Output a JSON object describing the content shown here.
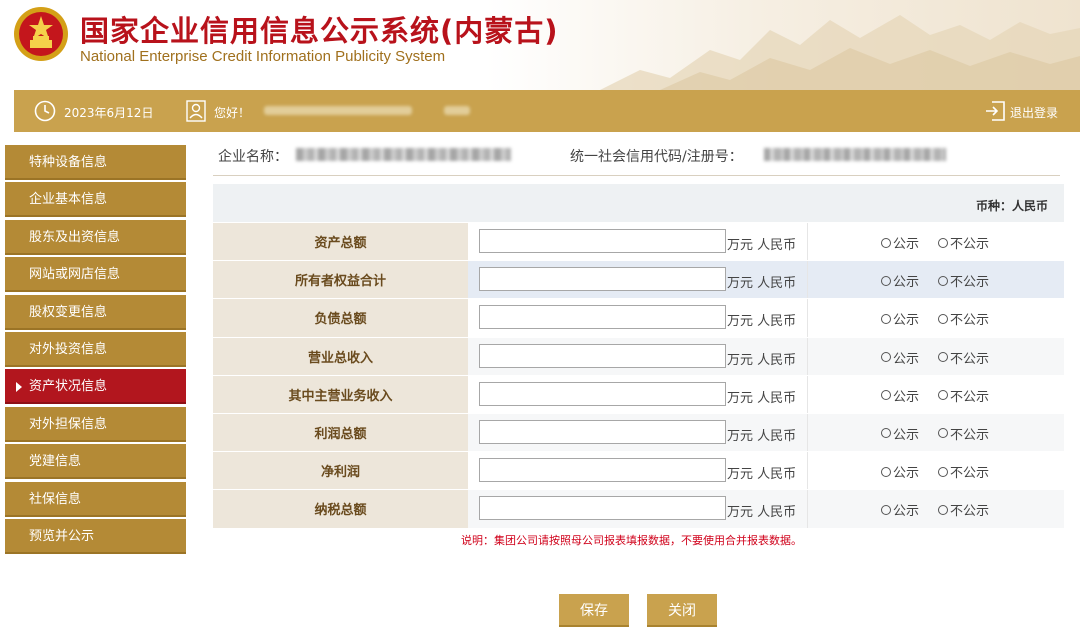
{
  "header": {
    "title_cn": "国家企业信用信息公示系统(内蒙古)",
    "title_en": "National Enterprise Credit Information Publicity System"
  },
  "topbar": {
    "date": "2023年6月12日",
    "greeting": "您好！",
    "logout": "退出登录"
  },
  "sidebar": {
    "items": [
      {
        "label": "特种设备信息"
      },
      {
        "label": "企业基本信息"
      },
      {
        "label": "股东及出资信息"
      },
      {
        "label": "网站或网店信息"
      },
      {
        "label": "股权变更信息"
      },
      {
        "label": "对外投资信息"
      },
      {
        "label": "资产状况信息",
        "active": true
      },
      {
        "label": "对外担保信息"
      },
      {
        "label": "党建信息"
      },
      {
        "label": "社保信息"
      },
      {
        "label": "预览并公示"
      }
    ]
  },
  "company": {
    "name_label": "企业名称：",
    "code_label": "统一社会信用代码/注册号："
  },
  "table": {
    "currency": "币种：人民币",
    "unit": "万元 人民币",
    "option_public": "公示",
    "option_private": "不公示",
    "rows": [
      {
        "label": "资产总额",
        "value": ""
      },
      {
        "label": "所有者权益合计",
        "value": ""
      },
      {
        "label": "负债总额",
        "value": ""
      },
      {
        "label": "营业总收入",
        "value": ""
      },
      {
        "label": "其中主营业务收入",
        "value": ""
      },
      {
        "label": "利润总额",
        "value": ""
      },
      {
        "label": "净利润",
        "value": ""
      },
      {
        "label": "纳税总额",
        "value": ""
      }
    ]
  },
  "note": "说明：集团公司请按照母公司报表填报数据，不要使用合并报表数据。",
  "buttons": {
    "save": "保存",
    "close": "关闭"
  }
}
